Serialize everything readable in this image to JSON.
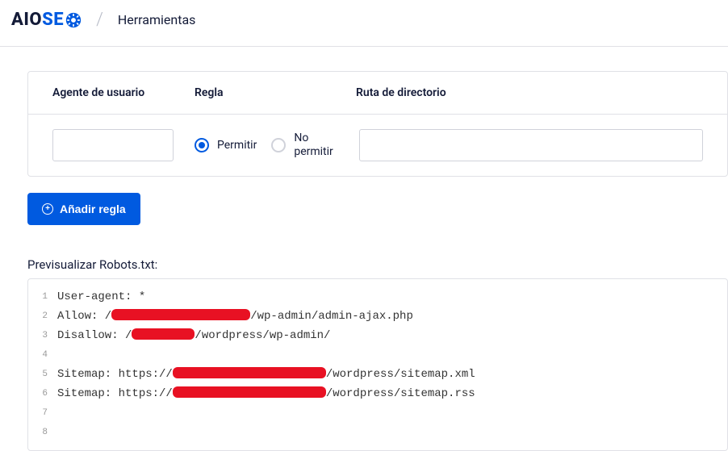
{
  "header": {
    "logo_aio": "AIO",
    "logo_seo": "SE",
    "page_title": "Herramientas"
  },
  "rules_table": {
    "col_user_agent": "Agente de usuario",
    "col_rule": "Regla",
    "col_path": "Ruta de directorio",
    "allow_label": "Permitir",
    "disallow_label": "No permitir",
    "user_agent_value": "",
    "path_value": ""
  },
  "buttons": {
    "add_rule": "Añadir regla"
  },
  "preview": {
    "label": "Previsualizar Robots.txt:",
    "lines": [
      {
        "num": "1",
        "prefix": "User-agent: *",
        "redact_w": 0,
        "suffix": ""
      },
      {
        "num": "2",
        "prefix": "Allow: /",
        "redact_w": 172,
        "suffix": "/wp-admin/admin-ajax.php"
      },
      {
        "num": "3",
        "prefix": "Disallow: /",
        "redact_w": 78,
        "suffix": "/wordpress/wp-admin/"
      },
      {
        "num": "4",
        "prefix": "",
        "redact_w": 0,
        "suffix": ""
      },
      {
        "num": "5",
        "prefix": "Sitemap: https://",
        "redact_w": 190,
        "suffix": "/wordpress/sitemap.xml"
      },
      {
        "num": "6",
        "prefix": "Sitemap: https://",
        "redact_w": 190,
        "suffix": "/wordpress/sitemap.rss"
      },
      {
        "num": "7",
        "prefix": "",
        "redact_w": 0,
        "suffix": ""
      },
      {
        "num": "8",
        "prefix": "",
        "redact_w": 0,
        "suffix": ""
      }
    ]
  }
}
